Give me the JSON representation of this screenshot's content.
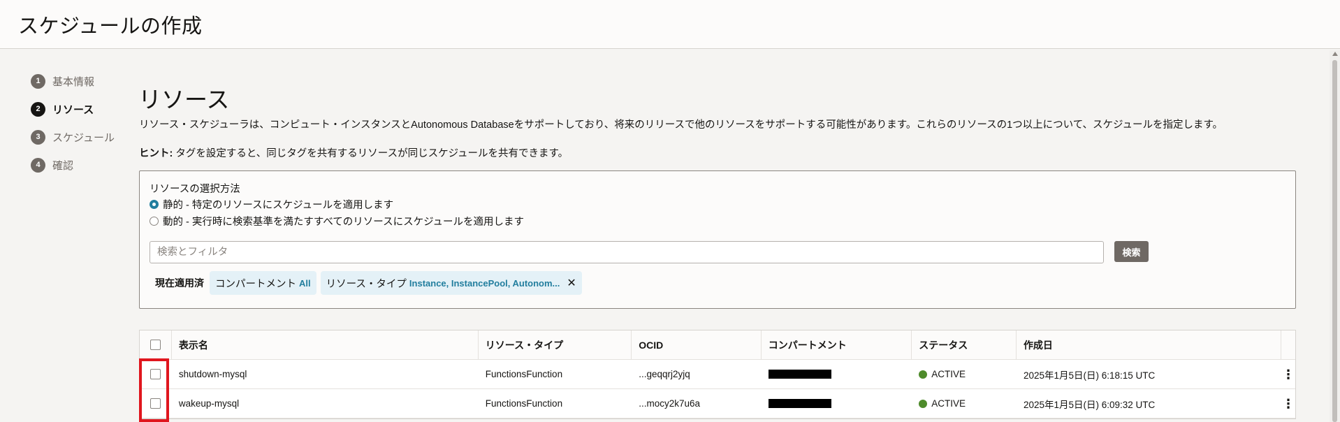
{
  "header": {
    "title": "スケジュールの作成"
  },
  "steps": [
    {
      "num": "1",
      "label": "基本情報"
    },
    {
      "num": "2",
      "label": "リソース"
    },
    {
      "num": "3",
      "label": "スケジュール"
    },
    {
      "num": "4",
      "label": "確認"
    }
  ],
  "section": {
    "title": "リソース",
    "description": "リソース・スケジューラは、コンピュート・インスタンスとAutonomous Databaseをサポートしており、将来のリリースで他のリソースをサポートする可能性があります。これらのリソースの1つ以上について、スケジュールを指定します。",
    "hint_label": "ヒント:",
    "hint_text": " タグを設定すると、同じタグを共有するリソースが同じスケジュールを共有できます。"
  },
  "selection": {
    "label": "リソースの選択方法",
    "options": [
      {
        "label": "静的 - 特定のリソースにスケジュールを適用します",
        "checked": true
      },
      {
        "label": "動的 - 実行時に検索基準を満たすすべてのリソースにスケジュールを適用します",
        "checked": false
      }
    ],
    "search_placeholder": "検索とフィルタ",
    "search_button": "検索",
    "applied_label": "現在適用済",
    "filters": [
      {
        "name": "コンパートメント",
        "value": "All"
      },
      {
        "name": "リソース・タイプ",
        "value": "Instance, InstancePool, Autonom..."
      }
    ]
  },
  "table": {
    "columns": [
      "表示名",
      "リソース・タイプ",
      "OCID",
      "コンパートメント",
      "ステータス",
      "作成日"
    ],
    "rows": [
      {
        "name": "shutdown-mysql",
        "type": "FunctionsFunction",
        "ocid": "...geqqrj2yjq",
        "status": "ACTIVE",
        "created": "2025年1月5日(日) 6:18:15 UTC"
      },
      {
        "name": "wakeup-mysql",
        "type": "FunctionsFunction",
        "ocid": "...mocy2k7u6a",
        "status": "ACTIVE",
        "created": "2025年1月5日(日) 6:09:32 UTC"
      }
    ]
  },
  "colors": {
    "accent": "#227e9e",
    "active": "#4e8b2b",
    "highlight": "#e0161e"
  }
}
